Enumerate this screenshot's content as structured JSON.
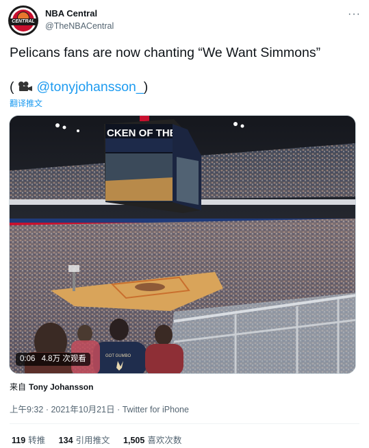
{
  "author": {
    "display_name": "NBA Central",
    "handle": "@TheNBACentral",
    "avatar_text": "CENTRAL"
  },
  "tweet": {
    "text": "Pelicans fans are now chanting “We Want Simmons”",
    "credit_open": "( ",
    "mention": "@tonyjohansson_",
    "credit_close": ")",
    "translate": "翻译推文"
  },
  "video": {
    "duration": "0:06",
    "views": "4.8万 次观看",
    "scoreboard_text": "CKEN OF THE",
    "jersey_text": "GOT GUMBO"
  },
  "source": {
    "label": "来自",
    "author": "Tony Johansson"
  },
  "meta": {
    "time": "上午9:32",
    "separator1": " · ",
    "date": "2021年10月21日",
    "separator2": " · ",
    "app": "Twitter for iPhone"
  },
  "stats": {
    "retweets_count": "119",
    "retweets_label": "转推",
    "quotes_count": "134",
    "quotes_label": "引用推文",
    "likes_count": "1,505",
    "likes_label": "喜欢次数"
  },
  "colors": {
    "link": "#1d9bf0",
    "secondary": "#536471",
    "primary_text": "#0f1419",
    "court": "#d9a45a"
  },
  "icons": [
    "more-icon",
    "camera-icon",
    "avatar-logo"
  ]
}
